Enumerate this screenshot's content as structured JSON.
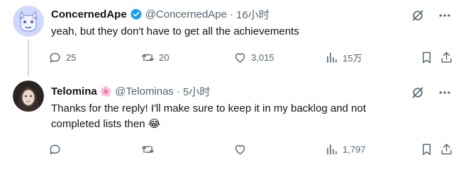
{
  "tweets": [
    {
      "name": "ConcernedApe",
      "handle": "@ConcernedApe",
      "separator": "·",
      "time": "16小时",
      "verified": true,
      "text": "yeah, but they don't have to get all the achievements",
      "actions": {
        "replies": "25",
        "retweets": "20",
        "likes": "3,015",
        "views": "15万"
      }
    },
    {
      "name": "Telomina",
      "handle": "@Telominas",
      "separator": "·",
      "time": "5小时",
      "name_emoji": "🌸",
      "text_line1": "Thanks for the reply! I'll make sure to keep it in my backlog and not",
      "text_line2": "completed lists then 😂",
      "actions": {
        "replies": "",
        "retweets": "",
        "likes": "",
        "views": "1,797"
      }
    }
  ],
  "colors": {
    "text": "#0f1419",
    "secondary": "#536471",
    "verified": "#1d9bf0",
    "thread_line": "#cfd9de"
  }
}
